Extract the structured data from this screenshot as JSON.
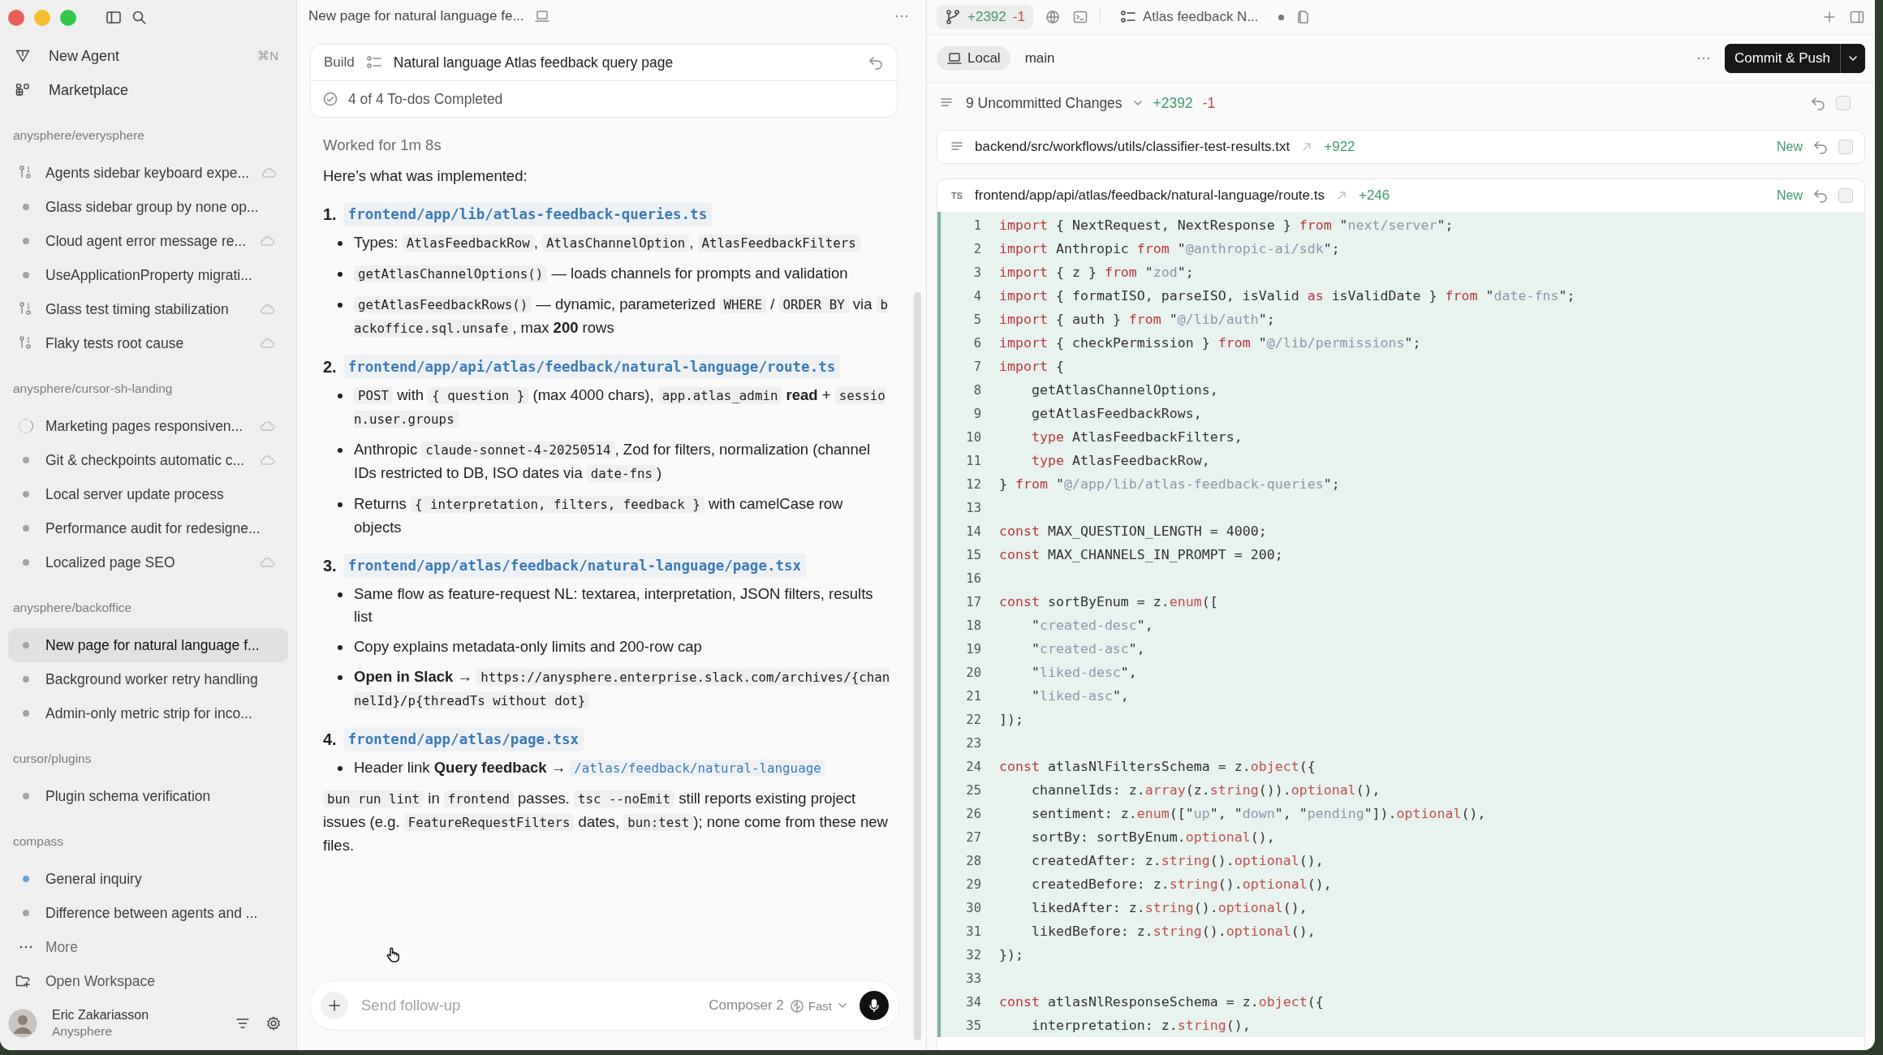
{
  "sidebar": {
    "actions": [
      {
        "kind": "agent",
        "label": "New Agent",
        "shortcut": "⌘N"
      },
      {
        "kind": "marketplace",
        "label": "Marketplace"
      }
    ],
    "groups": [
      {
        "name": "anysphere/everysphere",
        "items": [
          {
            "label": "Agents sidebar keyboard expe...",
            "kind": "worktree",
            "cloud": true,
            "selected": false
          },
          {
            "label": "Glass sidebar group by none op...",
            "kind": "dot",
            "color": "#a3a3a3",
            "cloud": false,
            "selected": false
          },
          {
            "label": "Cloud agent error message re...",
            "kind": "dot",
            "color": "#a3a3a3",
            "cloud": true,
            "selected": false
          },
          {
            "label": "UseApplicationProperty migrati...",
            "kind": "dot",
            "color": "#a3a3a3",
            "cloud": false,
            "selected": false
          },
          {
            "label": "Glass test timing stabilization",
            "kind": "worktree",
            "cloud": true,
            "selected": false
          },
          {
            "label": "Flaky tests root cause",
            "kind": "worktree",
            "cloud": true,
            "selected": false
          }
        ]
      },
      {
        "name": "anysphere/cursor-sh-landing",
        "items": [
          {
            "label": "Marketing pages responsiven...",
            "kind": "loading",
            "cloud": true,
            "selected": false
          },
          {
            "label": "Git & checkpoints automatic c...",
            "kind": "dot",
            "color": "#a3a3a3",
            "cloud": true,
            "selected": false
          },
          {
            "label": "Local server update process",
            "kind": "dot",
            "color": "#a3a3a3",
            "cloud": false,
            "selected": false
          },
          {
            "label": "Performance audit for redesigne...",
            "kind": "dot",
            "color": "#a3a3a3",
            "cloud": false,
            "selected": false
          },
          {
            "label": "Localized page SEO",
            "kind": "dot",
            "color": "#a3a3a3",
            "cloud": true,
            "selected": false
          }
        ]
      },
      {
        "name": "anysphere/backoffice",
        "items": [
          {
            "label": "New page for natural language f...",
            "kind": "dot",
            "color": "#a3a3a3",
            "cloud": false,
            "selected": true
          },
          {
            "label": "Background worker retry handling",
            "kind": "dot",
            "color": "#a3a3a3",
            "cloud": false,
            "selected": false
          },
          {
            "label": "Admin-only metric strip for inco...",
            "kind": "dot",
            "color": "#a3a3a3",
            "cloud": false,
            "selected": false
          }
        ]
      },
      {
        "name": "cursor/plugins",
        "items": [
          {
            "label": "Plugin schema verification",
            "kind": "dot",
            "color": "#a3a3a3",
            "cloud": false,
            "selected": false
          }
        ]
      },
      {
        "name": "compass",
        "items": [
          {
            "label": "General inquiry",
            "kind": "dot",
            "color": "#6f9fd0",
            "cloud": false,
            "selected": false
          },
          {
            "label": "Difference between agents and ...",
            "kind": "dot",
            "color": "#a3a3a3",
            "cloud": false,
            "selected": false
          }
        ]
      }
    ],
    "more": "More",
    "open_workspace": "Open Workspace",
    "user": {
      "name": "Eric Zakariasson",
      "org": "Anysphere"
    }
  },
  "chat": {
    "title": "New page for natural language fe...",
    "todo_card": {
      "mode": "Build",
      "plan": "Natural language Atlas feedback query page",
      "status": "4 of 4 To-dos Completed"
    },
    "worked": "Worked for 1m 8s",
    "intro": "Here’s what was implemented:",
    "sections": [
      {
        "number": "1.",
        "path": "frontend/app/lib/atlas-feedback-queries.ts",
        "bullets": [
          [
            {
              "kind": "text",
              "text": "Types: "
            },
            {
              "kind": "code",
              "text": "AtlasFeedbackRow"
            },
            {
              "kind": "text",
              "text": ", "
            },
            {
              "kind": "code",
              "text": "AtlasChannelOption"
            },
            {
              "kind": "text",
              "text": ", "
            },
            {
              "kind": "code",
              "text": "AtlasFeedbackFilters"
            }
          ],
          [
            {
              "kind": "code",
              "text": "getAtlasChannelOptions()"
            },
            {
              "kind": "text",
              "text": " — loads channels for prompts and validation"
            }
          ],
          [
            {
              "kind": "code",
              "text": "getAtlasFeedbackRows()"
            },
            {
              "kind": "text",
              "text": " — dynamic, parameterized "
            },
            {
              "kind": "code",
              "text": "WHERE"
            },
            {
              "kind": "text",
              "text": " / "
            },
            {
              "kind": "code",
              "text": "ORDER BY"
            },
            {
              "kind": "text",
              "text": " via "
            },
            {
              "kind": "code",
              "text": "backoffice.sql.unsafe"
            },
            {
              "kind": "text",
              "text": ", max "
            },
            {
              "kind": "bold",
              "text": "200"
            },
            {
              "kind": "text",
              "text": " rows"
            }
          ]
        ]
      },
      {
        "number": "2.",
        "path": "frontend/app/api/atlas/feedback/natural-language/route.ts",
        "bullets": [
          [
            {
              "kind": "code",
              "text": "POST"
            },
            {
              "kind": "text",
              "text": " with "
            },
            {
              "kind": "code",
              "text": "{ question }"
            },
            {
              "kind": "text",
              "text": " (max 4000 chars), "
            },
            {
              "kind": "code",
              "text": "app.atlas_admin"
            },
            {
              "kind": "bold",
              "text": " read"
            },
            {
              "kind": "text",
              "text": " + "
            },
            {
              "kind": "code",
              "text": "session.user.groups"
            }
          ],
          [
            {
              "kind": "text",
              "text": "Anthropic "
            },
            {
              "kind": "code",
              "text": "claude-sonnet-4-20250514"
            },
            {
              "kind": "text",
              "text": ", Zod for filters, normalization (channel IDs restricted to DB, ISO dates via "
            },
            {
              "kind": "code",
              "text": "date-fns"
            },
            {
              "kind": "text",
              "text": ")"
            }
          ],
          [
            {
              "kind": "text",
              "text": "Returns "
            },
            {
              "kind": "code",
              "text": "{ interpretation, filters, feedback }"
            },
            {
              "kind": "text",
              "text": " with camelCase row objects"
            }
          ]
        ]
      },
      {
        "number": "3.",
        "path": "frontend/app/atlas/feedback/natural-language/page.tsx",
        "bullets": [
          [
            {
              "kind": "text",
              "text": "Same flow as feature-request NL: textarea, interpretation, JSON filters, results list"
            }
          ],
          [
            {
              "kind": "text",
              "text": "Copy explains metadata-only limits and 200-row cap"
            }
          ],
          [
            {
              "kind": "bold",
              "text": "Open in Slack"
            },
            {
              "kind": "text",
              "text": " → "
            },
            {
              "kind": "code",
              "text": "https://anysphere.enterprise.slack.com/archives/{channelId}/p{threadTs without dot}"
            }
          ]
        ]
      },
      {
        "number": "4.",
        "path": "frontend/app/atlas/page.tsx",
        "bullets": [
          [
            {
              "kind": "text",
              "text": "Header link "
            },
            {
              "kind": "bold",
              "text": "Query feedback"
            },
            {
              "kind": "text",
              "text": " → "
            },
            {
              "kind": "link",
              "text": "/atlas/feedback/natural-language"
            }
          ]
        ]
      }
    ],
    "summary": [
      {
        "kind": "code",
        "text": "bun run lint"
      },
      {
        "kind": "text",
        "text": " in "
      },
      {
        "kind": "code",
        "text": "frontend"
      },
      {
        "kind": "text",
        "text": " passes. "
      },
      {
        "kind": "code",
        "text": "tsc --noEmit"
      },
      {
        "kind": "text",
        "text": " still reports existing project issues (e.g. "
      },
      {
        "kind": "code",
        "text": "FeatureRequestFilters"
      },
      {
        "kind": "text",
        "text": " dates, "
      },
      {
        "kind": "code",
        "text": "bun:test"
      },
      {
        "kind": "text",
        "text": "); none come from these new files."
      }
    ],
    "composer": {
      "placeholder": "Send follow-up",
      "model": "Composer 2",
      "speed": "Fast"
    }
  },
  "review": {
    "tabs": [
      {
        "kind": "diff",
        "added": "+2392",
        "removed": "-1",
        "selected": true
      },
      {
        "kind": "agent",
        "label": "Atlas feedback N...",
        "selected": false
      }
    ],
    "location": "Local",
    "branch": "main",
    "commit": "Commit & Push",
    "changes": {
      "label": "9 Uncommitted Changes",
      "added": "+2392",
      "removed": "-1",
      "checked": false
    },
    "files": [
      {
        "kind": "text",
        "path": "backend/src/workflows/utils/classifier-test-results.txt",
        "added": "+922",
        "status": "New",
        "checked": false
      },
      {
        "kind": "code",
        "badge": "TS",
        "path": "frontend/app/api/atlas/feedback/natural-language/route.ts",
        "added": "+246",
        "status": "New",
        "checked": false,
        "lines": [
          {
            "number": "1",
            "added": true,
            "tokens": [
              {
                "kind": "kw",
                "text": "import"
              },
              {
                "kind": "plain",
                "text": " { NextRequest, NextResponse } "
              },
              {
                "kind": "kw",
                "text": "from"
              },
              {
                "kind": "plain",
                "text": " \""
              },
              {
                "kind": "str",
                "text": "next/server"
              },
              {
                "kind": "plain",
                "text": "\";"
              }
            ]
          },
          {
            "number": "2",
            "added": true,
            "tokens": [
              {
                "kind": "kw",
                "text": "import"
              },
              {
                "kind": "plain",
                "text": " Anthropic "
              },
              {
                "kind": "kw",
                "text": "from"
              },
              {
                "kind": "plain",
                "text": " \""
              },
              {
                "kind": "str",
                "text": "@anthropic-ai/sdk"
              },
              {
                "kind": "plain",
                "text": "\";"
              }
            ]
          },
          {
            "number": "3",
            "added": true,
            "tokens": [
              {
                "kind": "kw",
                "text": "import"
              },
              {
                "kind": "plain",
                "text": " { z } "
              },
              {
                "kind": "kw",
                "text": "from"
              },
              {
                "kind": "plain",
                "text": " \""
              },
              {
                "kind": "str",
                "text": "zod"
              },
              {
                "kind": "plain",
                "text": "\";"
              }
            ]
          },
          {
            "number": "4",
            "added": true,
            "tokens": [
              {
                "kind": "kw",
                "text": "import"
              },
              {
                "kind": "plain",
                "text": " { formatISO, parseISO, isValid "
              },
              {
                "kind": "kw",
                "text": "as"
              },
              {
                "kind": "plain",
                "text": " isValidDate } "
              },
              {
                "kind": "kw",
                "text": "from"
              },
              {
                "kind": "plain",
                "text": " \""
              },
              {
                "kind": "str",
                "text": "date-fns"
              },
              {
                "kind": "plain",
                "text": "\";"
              }
            ]
          },
          {
            "number": "5",
            "added": true,
            "tokens": [
              {
                "kind": "kw",
                "text": "import"
              },
              {
                "kind": "plain",
                "text": " { auth } "
              },
              {
                "kind": "kw",
                "text": "from"
              },
              {
                "kind": "plain",
                "text": " \""
              },
              {
                "kind": "str",
                "text": "@/lib/auth"
              },
              {
                "kind": "plain",
                "text": "\";"
              }
            ]
          },
          {
            "number": "6",
            "added": true,
            "tokens": [
              {
                "kind": "kw",
                "text": "import"
              },
              {
                "kind": "plain",
                "text": " { checkPermission } "
              },
              {
                "kind": "kw",
                "text": "from"
              },
              {
                "kind": "plain",
                "text": " \""
              },
              {
                "kind": "str",
                "text": "@/lib/permissions"
              },
              {
                "kind": "plain",
                "text": "\";"
              }
            ]
          },
          {
            "number": "7",
            "added": true,
            "tokens": [
              {
                "kind": "kw",
                "text": "import"
              },
              {
                "kind": "plain",
                "text": " {"
              }
            ]
          },
          {
            "number": "8",
            "added": true,
            "tokens": [
              {
                "kind": "plain",
                "text": "    getAtlasChannelOptions,"
              }
            ]
          },
          {
            "number": "9",
            "added": true,
            "tokens": [
              {
                "kind": "plain",
                "text": "    getAtlasFeedbackRows,"
              }
            ]
          },
          {
            "number": "10",
            "added": true,
            "tokens": [
              {
                "kind": "kw",
                "text": "    type"
              },
              {
                "kind": "plain",
                "text": " AtlasFeedbackFilters,"
              }
            ]
          },
          {
            "number": "11",
            "added": true,
            "tokens": [
              {
                "kind": "kw",
                "text": "    type"
              },
              {
                "kind": "plain",
                "text": " AtlasFeedbackRow,"
              }
            ]
          },
          {
            "number": "12",
            "added": true,
            "tokens": [
              {
                "kind": "plain",
                "text": "} "
              },
              {
                "kind": "kw",
                "text": "from"
              },
              {
                "kind": "plain",
                "text": " \""
              },
              {
                "kind": "str",
                "text": "@/app/lib/atlas-feedback-queries"
              },
              {
                "kind": "plain",
                "text": "\";"
              }
            ]
          },
          {
            "number": "13",
            "added": true
          },
          {
            "number": "14",
            "added": true,
            "tokens": [
              {
                "kind": "kw",
                "text": "const"
              },
              {
                "kind": "plain",
                "text": " MAX_QUESTION_LENGTH = 4000;"
              }
            ]
          },
          {
            "number": "15",
            "added": true,
            "tokens": [
              {
                "kind": "kw",
                "text": "const"
              },
              {
                "kind": "plain",
                "text": " MAX_CHANNELS_IN_PROMPT = 200;"
              }
            ]
          },
          {
            "number": "16",
            "added": true
          },
          {
            "number": "17",
            "added": true,
            "tokens": [
              {
                "kind": "kw",
                "text": "const"
              },
              {
                "kind": "plain",
                "text": " sortByEnum = z."
              },
              {
                "kind": "fn",
                "text": "enum"
              },
              {
                "kind": "plain",
                "text": "(["
              }
            ]
          },
          {
            "number": "18",
            "added": true,
            "tokens": [
              {
                "kind": "plain",
                "text": "    \""
              },
              {
                "kind": "str",
                "text": "created-desc"
              },
              {
                "kind": "plain",
                "text": "\","
              }
            ]
          },
          {
            "number": "19",
            "added": true,
            "tokens": [
              {
                "kind": "plain",
                "text": "    \""
              },
              {
                "kind": "str",
                "text": "created-asc"
              },
              {
                "kind": "plain",
                "text": "\","
              }
            ]
          },
          {
            "number": "20",
            "added": true,
            "tokens": [
              {
                "kind": "plain",
                "text": "    \""
              },
              {
                "kind": "str",
                "text": "liked-desc"
              },
              {
                "kind": "plain",
                "text": "\","
              }
            ]
          },
          {
            "number": "21",
            "added": true,
            "tokens": [
              {
                "kind": "plain",
                "text": "    \""
              },
              {
                "kind": "str",
                "text": "liked-asc"
              },
              {
                "kind": "plain",
                "text": "\","
              }
            ]
          },
          {
            "number": "22",
            "added": true,
            "tokens": [
              {
                "kind": "plain",
                "text": "]);"
              }
            ]
          },
          {
            "number": "23",
            "added": true
          },
          {
            "number": "24",
            "added": true,
            "tokens": [
              {
                "kind": "kw",
                "text": "const"
              },
              {
                "kind": "plain",
                "text": " atlasNlFiltersSchema = z."
              },
              {
                "kind": "fn",
                "text": "object"
              },
              {
                "kind": "plain",
                "text": "({"
              }
            ]
          },
          {
            "number": "25",
            "added": true,
            "tokens": [
              {
                "kind": "plain",
                "text": "    channelIds: z."
              },
              {
                "kind": "fn",
                "text": "array"
              },
              {
                "kind": "plain",
                "text": "(z."
              },
              {
                "kind": "fn",
                "text": "string"
              },
              {
                "kind": "plain",
                "text": "())."
              },
              {
                "kind": "fn",
                "text": "optional"
              },
              {
                "kind": "plain",
                "text": "(),"
              }
            ]
          },
          {
            "number": "26",
            "added": true,
            "tokens": [
              {
                "kind": "plain",
                "text": "    sentiment: z."
              },
              {
                "kind": "fn",
                "text": "enum"
              },
              {
                "kind": "plain",
                "text": "([\""
              },
              {
                "kind": "str",
                "text": "up"
              },
              {
                "kind": "plain",
                "text": "\", \""
              },
              {
                "kind": "str",
                "text": "down"
              },
              {
                "kind": "plain",
                "text": "\", \""
              },
              {
                "kind": "str",
                "text": "pending"
              },
              {
                "kind": "plain",
                "text": "\"])."
              },
              {
                "kind": "fn",
                "text": "optional"
              },
              {
                "kind": "plain",
                "text": "(),"
              }
            ]
          },
          {
            "number": "27",
            "added": true,
            "tokens": [
              {
                "kind": "plain",
                "text": "    sortBy: sortByEnum."
              },
              {
                "kind": "fn",
                "text": "optional"
              },
              {
                "kind": "plain",
                "text": "(),"
              }
            ]
          },
          {
            "number": "28",
            "added": true,
            "tokens": [
              {
                "kind": "plain",
                "text": "    createdAfter: z."
              },
              {
                "kind": "fn",
                "text": "string"
              },
              {
                "kind": "plain",
                "text": "()."
              },
              {
                "kind": "fn",
                "text": "optional"
              },
              {
                "kind": "plain",
                "text": "(),"
              }
            ]
          },
          {
            "number": "29",
            "added": true,
            "tokens": [
              {
                "kind": "plain",
                "text": "    createdBefore: z."
              },
              {
                "kind": "fn",
                "text": "string"
              },
              {
                "kind": "plain",
                "text": "()."
              },
              {
                "kind": "fn",
                "text": "optional"
              },
              {
                "kind": "plain",
                "text": "(),"
              }
            ]
          },
          {
            "number": "30",
            "added": true,
            "tokens": [
              {
                "kind": "plain",
                "text": "    likedAfter: z."
              },
              {
                "kind": "fn",
                "text": "string"
              },
              {
                "kind": "plain",
                "text": "()."
              },
              {
                "kind": "fn",
                "text": "optional"
              },
              {
                "kind": "plain",
                "text": "(),"
              }
            ]
          },
          {
            "number": "31",
            "added": true,
            "tokens": [
              {
                "kind": "plain",
                "text": "    likedBefore: z."
              },
              {
                "kind": "fn",
                "text": "string"
              },
              {
                "kind": "plain",
                "text": "()."
              },
              {
                "kind": "fn",
                "text": "optional"
              },
              {
                "kind": "plain",
                "text": "(),"
              }
            ]
          },
          {
            "number": "32",
            "added": true,
            "tokens": [
              {
                "kind": "plain",
                "text": "});"
              }
            ]
          },
          {
            "number": "33",
            "added": true
          },
          {
            "number": "34",
            "added": true,
            "tokens": [
              {
                "kind": "kw",
                "text": "const"
              },
              {
                "kind": "plain",
                "text": " atlasNlResponseSchema = z."
              },
              {
                "kind": "fn",
                "text": "object"
              },
              {
                "kind": "plain",
                "text": "({"
              }
            ]
          },
          {
            "number": "35",
            "added": true,
            "tokens": [
              {
                "kind": "plain",
                "text": "    interpretation: z."
              },
              {
                "kind": "fn",
                "text": "string"
              },
              {
                "kind": "plain",
                "text": "(),"
              }
            ]
          }
        ]
      }
    ]
  }
}
